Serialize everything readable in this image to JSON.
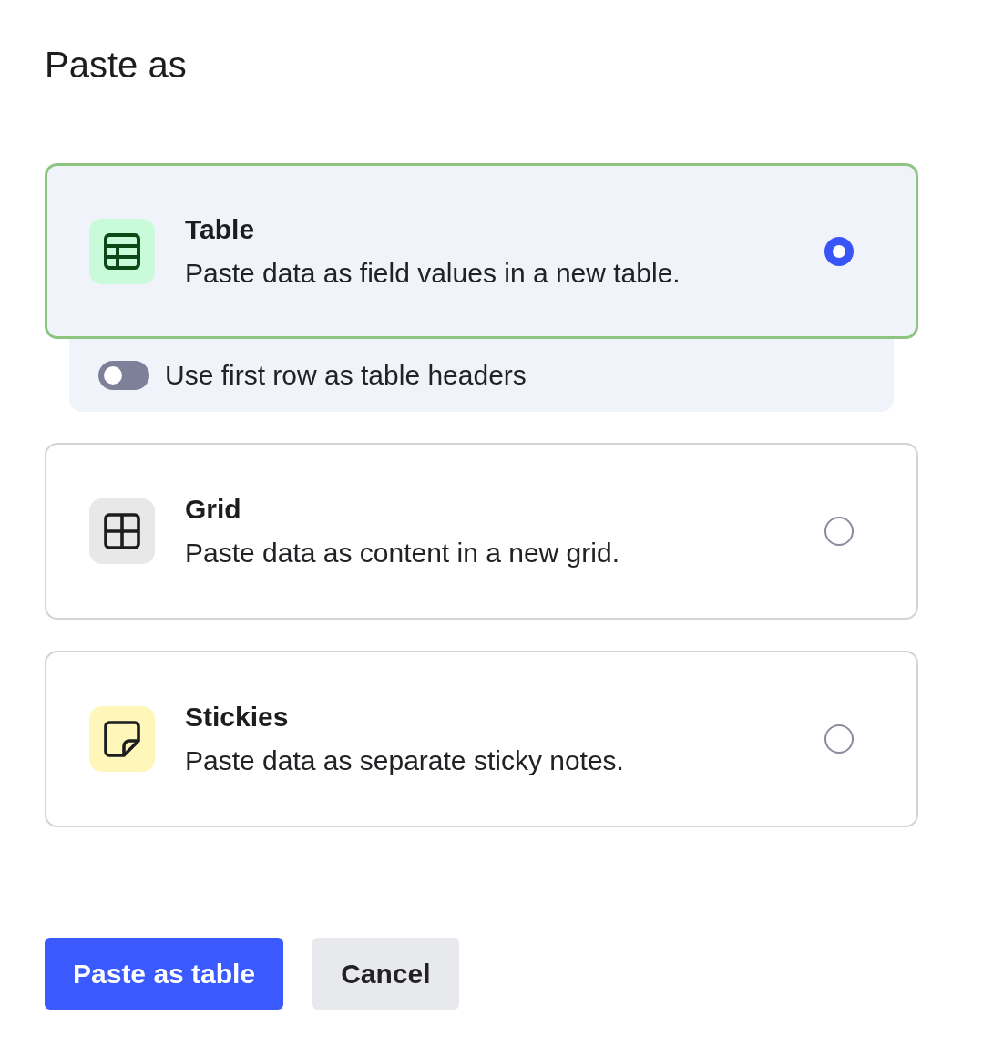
{
  "dialog": {
    "title": "Paste as"
  },
  "options": [
    {
      "kind": "table",
      "title": "Table",
      "description": "Paste data as field values in a new table.",
      "selected": true,
      "toggle": {
        "label": "Use first row as table headers",
        "on": false
      }
    },
    {
      "kind": "grid",
      "title": "Grid",
      "description": "Paste data as content in a new grid.",
      "selected": false
    },
    {
      "kind": "stickies",
      "title": "Stickies",
      "description": "Paste data as separate sticky notes.",
      "selected": false
    }
  ],
  "buttons": [
    {
      "kind": "primary",
      "label": "Paste as table"
    },
    {
      "kind": "secondary",
      "label": "Cancel"
    }
  ]
}
